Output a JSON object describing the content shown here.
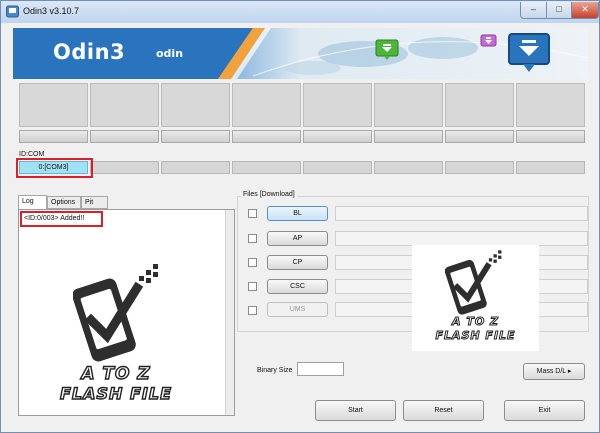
{
  "window": {
    "title": "Odin3 v3.10.7",
    "minimize": "–",
    "maximize": "□",
    "close": "✕"
  },
  "banner": {
    "title": "Odin3",
    "subtitle": "odin"
  },
  "id_com": {
    "label": "ID:COM",
    "ports": [
      "0:[COM3]",
      "",
      "",
      "",
      "",
      "",
      "",
      ""
    ]
  },
  "tabs": [
    "Log",
    "Options",
    "Pit"
  ],
  "log": {
    "lines": [
      "<ID:0/003> Added!!"
    ]
  },
  "files": {
    "group_label": "Files [Download]",
    "buttons": [
      "BL",
      "AP",
      "CP",
      "CSC",
      "UMS"
    ]
  },
  "watermark": {
    "line1": "A TO Z",
    "line2": "FLASH FILE"
  },
  "binary": {
    "label": "Binary Size",
    "value": ""
  },
  "actions": {
    "mass_dl": "Mass D/L ▸",
    "start": "Start",
    "reset": "Reset",
    "exit": "Exit"
  },
  "colors": {
    "active_port": "#9fe2f5",
    "highlight_box": "#d9202b",
    "banner_blue": "#1f6bb3"
  }
}
